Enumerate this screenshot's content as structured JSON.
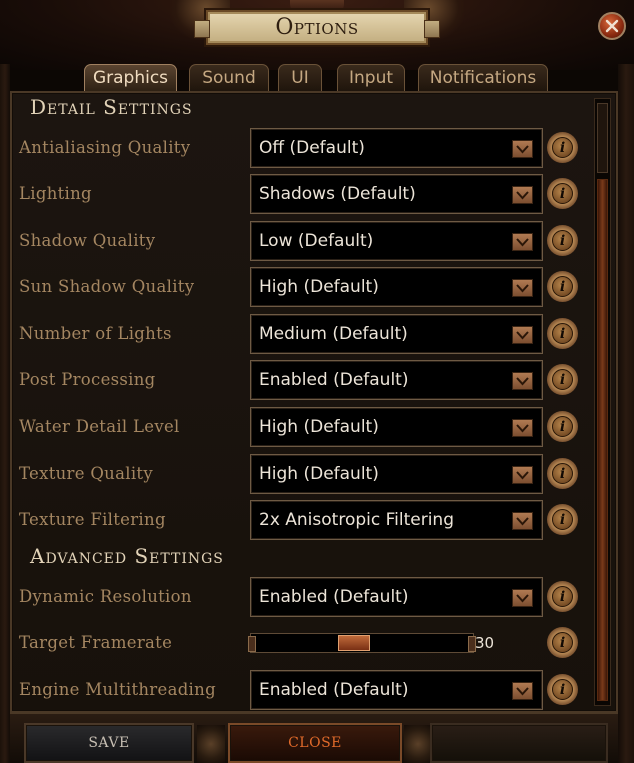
{
  "window": {
    "title": "Options"
  },
  "tabs": [
    {
      "label": "Graphics",
      "active": true
    },
    {
      "label": "Sound",
      "active": false
    },
    {
      "label": "UI",
      "active": false
    },
    {
      "label": "Input",
      "active": false
    },
    {
      "label": "Notifications",
      "active": false
    }
  ],
  "sections": {
    "detail": "Detail Settings",
    "advanced": "Advanced Settings"
  },
  "detail_settings": [
    {
      "label": "Antialiasing Quality",
      "value": "Off (Default)"
    },
    {
      "label": "Lighting",
      "value": "Shadows (Default)"
    },
    {
      "label": "Shadow Quality",
      "value": "Low (Default)"
    },
    {
      "label": "Sun Shadow Quality",
      "value": "High (Default)"
    },
    {
      "label": "Number of Lights",
      "value": "Medium (Default)"
    },
    {
      "label": "Post Processing",
      "value": "Enabled (Default)"
    },
    {
      "label": "Water Detail Level",
      "value": "High (Default)"
    },
    {
      "label": "Texture Quality",
      "value": "High (Default)"
    },
    {
      "label": "Texture Filtering",
      "value": "2x Anisotropic Filtering"
    }
  ],
  "advanced_settings": {
    "dynamic_resolution": {
      "label": "Dynamic Resolution",
      "value": "Enabled (Default)"
    },
    "target_framerate": {
      "label": "Target Framerate",
      "value": "30",
      "slider_fraction": 0.46
    },
    "engine_multithreading": {
      "label": "Engine Multithreading",
      "value": "Enabled (Default)"
    }
  },
  "info_glyph": "i",
  "buttons": {
    "save": "SAVE",
    "close": "CLOSE"
  },
  "icons": {
    "close": "close-x-icon",
    "dropdown": "chevron-down-icon",
    "info": "info-icon"
  },
  "colors": {
    "label": "#a48661",
    "value": "#ece4d8",
    "heading": "#e2d3b8",
    "accent_orange": "#e06a2a"
  }
}
